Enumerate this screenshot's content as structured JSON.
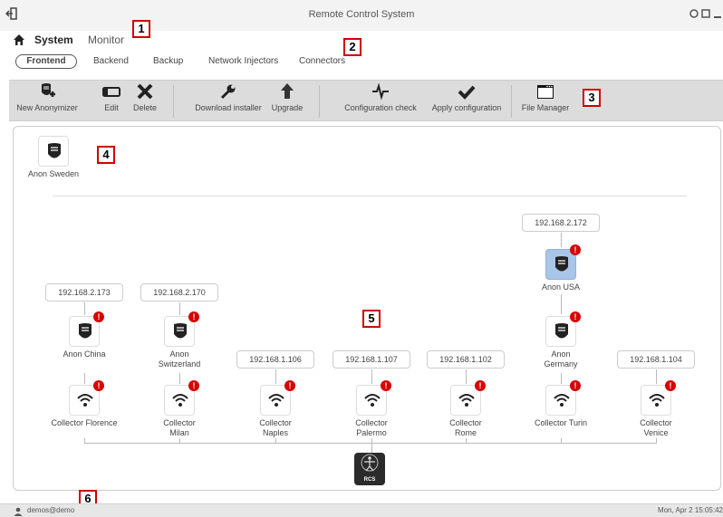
{
  "window": {
    "title": "Remote Control System"
  },
  "nav": {
    "system": "System",
    "monitor": "Monitor"
  },
  "subtabs": [
    "Frontend",
    "Backend",
    "Backup",
    "Network Injectors",
    "Connectors"
  ],
  "toolbar": {
    "new_anonymizer": "New Anonymizer",
    "edit": "Edit",
    "delete": "Delete",
    "download_installer": "Download installer",
    "upgrade": "Upgrade",
    "configuration_check": "Configuration check",
    "apply_configuration": "Apply configuration",
    "file_manager": "File Manager"
  },
  "frontend": {
    "top_anonymizer": {
      "name": "Anon Sweden"
    },
    "anon_usa": {
      "ip": "192.168.2.172",
      "name": "Anon USA",
      "selected": true
    },
    "anonymizers": [
      {
        "name": "Anon China",
        "ip": "192.168.2.173"
      },
      {
        "name": "Anon Switzerland",
        "ip": "192.168.2.170"
      },
      {
        "name": "Anon Germany"
      }
    ],
    "collectors": [
      {
        "name": "Collector Florence"
      },
      {
        "name": "Collector Milan"
      },
      {
        "name": "Collector Naples",
        "ip": "192.168.1.106"
      },
      {
        "name": "Collector Palermo",
        "ip": "192.168.1.107"
      },
      {
        "name": "Collector Rome",
        "ip": "192.168.1.102"
      },
      {
        "name": "Collector Turin"
      },
      {
        "name": "Collector Venice",
        "ip": "192.168.1.104"
      }
    ],
    "rcs_label": "RCS",
    "alert_glyph": "!"
  },
  "callouts": [
    "1",
    "2",
    "3",
    "4",
    "5",
    "6"
  ],
  "status": {
    "user": "demos@demo",
    "datetime": "Mon, Apr 2  15:05:42"
  },
  "colors": {
    "alert": "#d60000",
    "selected": "#a9c6e8",
    "callout_border": "#d00000"
  }
}
